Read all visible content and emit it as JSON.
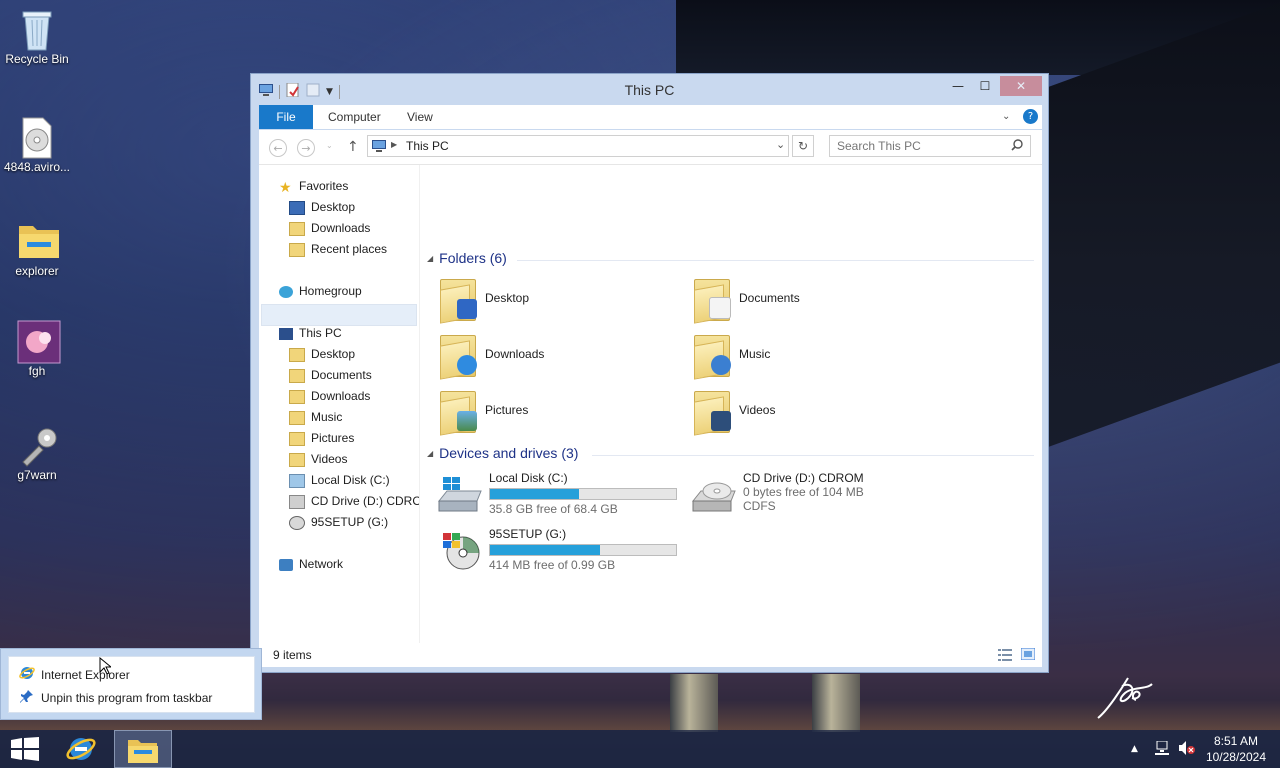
{
  "desktop": {
    "icons": [
      {
        "label": "Recycle Bin"
      },
      {
        "label": "4848.aviro..."
      },
      {
        "label": "explorer"
      },
      {
        "label": "fgh"
      },
      {
        "label": "g7warn"
      }
    ]
  },
  "window": {
    "title": "This PC",
    "controls": {
      "minimize": "—",
      "maximize": "☐",
      "close": "✕"
    },
    "ribbon": {
      "tabs": [
        "File",
        "Computer",
        "View"
      ]
    },
    "address": {
      "location": "This PC",
      "search_placeholder": "Search This PC"
    },
    "nav": {
      "favorites": "Favorites",
      "fav_items": [
        "Desktop",
        "Downloads",
        "Recent places"
      ],
      "homegroup": "Homegroup",
      "thispc": "This PC",
      "pc_items": [
        "Desktop",
        "Documents",
        "Downloads",
        "Music",
        "Pictures",
        "Videos",
        "Local Disk (C:)",
        "CD Drive (D:) CDROM",
        "95SETUP (G:)"
      ],
      "network": "Network"
    },
    "folders_header": "Folders (6)",
    "folders": [
      "Desktop",
      "Documents",
      "Downloads",
      "Music",
      "Pictures",
      "Videos"
    ],
    "drives_header": "Devices and drives (3)",
    "drives": [
      {
        "name": "Local Disk (C:)",
        "free": "35.8 GB free of 68.4 GB",
        "used_fraction": 0.477
      },
      {
        "name": "CD Drive (D:) CDROM",
        "free": "0 bytes free of 104 MB",
        "fs": "CDFS"
      },
      {
        "name": "95SETUP (G:)",
        "free": "414 MB free of 0.99 GB",
        "used_fraction": 0.59
      }
    ],
    "status": "9 items"
  },
  "jumplist": {
    "items": [
      "Internet Explorer",
      "Unpin this program from taskbar"
    ]
  },
  "taskbar": {
    "time": "8:51 AM",
    "date": "10/28/2024"
  },
  "colors": {
    "accent": "#1979ca",
    "drive_bar": "#26a0da",
    "group_header": "#1e3287"
  }
}
